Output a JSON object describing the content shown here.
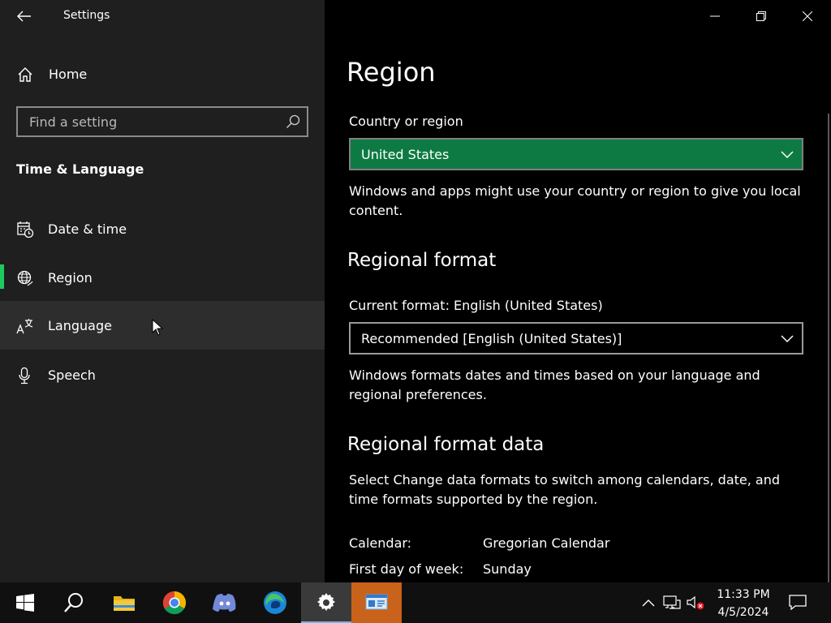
{
  "window": {
    "app_title": "Settings"
  },
  "sidebar": {
    "home_label": "Home",
    "search_placeholder": "Find a setting",
    "section_heading": "Time & Language",
    "items": [
      {
        "label": "Date & time",
        "icon": "calendar-clock-icon",
        "selected": false
      },
      {
        "label": "Region",
        "icon": "globe-icon",
        "selected": true
      },
      {
        "label": "Language",
        "icon": "language-icon",
        "selected": false
      },
      {
        "label": "Speech",
        "icon": "microphone-icon",
        "selected": false
      }
    ]
  },
  "main": {
    "title": "Region",
    "country": {
      "label": "Country or region",
      "value": "United States",
      "description": "Windows and apps might use your country or region to give you local content."
    },
    "regional_format": {
      "title": "Regional format",
      "current_label": "Current format: English (United States)",
      "value": "Recommended [English (United States)]",
      "description": "Windows formats dates and times based on your language and regional preferences."
    },
    "format_data": {
      "title": "Regional format data",
      "description": "Select Change data formats to switch among calendars, date, and time formats supported by the region.",
      "rows": [
        {
          "key": "Calendar:",
          "value": "Gregorian Calendar"
        },
        {
          "key": "First day of week:",
          "value": "Sunday"
        }
      ]
    }
  },
  "taskbar": {
    "time": "11:33 PM",
    "date": "4/5/2024"
  },
  "colors": {
    "accent_green": "#0e7a43",
    "selection_indicator": "#1ec95f",
    "sidebar_bg": "#1f1f1f"
  }
}
